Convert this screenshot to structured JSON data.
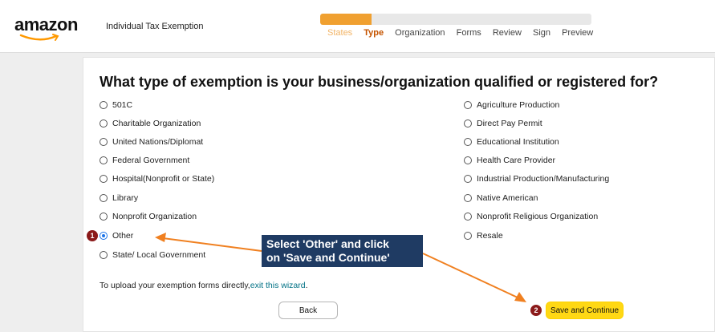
{
  "header": {
    "logo": "amazon",
    "app_title": "Individual Tax Exemption",
    "progress_fraction": 0.19,
    "steps": [
      {
        "label": "States",
        "state": "done"
      },
      {
        "label": "Type",
        "state": "active"
      },
      {
        "label": "Organization",
        "state": "pending"
      },
      {
        "label": "Forms",
        "state": "pending"
      },
      {
        "label": "Review",
        "state": "pending"
      },
      {
        "label": "Sign",
        "state": "pending"
      },
      {
        "label": "Preview",
        "state": "pending"
      }
    ]
  },
  "main": {
    "question": "What type of exemption is your business/organization qualified or registered for?",
    "left_options": [
      {
        "label": "501C",
        "checked": false
      },
      {
        "label": "Charitable Organization",
        "checked": false
      },
      {
        "label": "United Nations/Diplomat",
        "checked": false
      },
      {
        "label": "Federal Government",
        "checked": false
      },
      {
        "label": "Hospital(Nonprofit or State)",
        "checked": false
      },
      {
        "label": "Library",
        "checked": false
      },
      {
        "label": "Nonprofit Organization",
        "checked": false
      },
      {
        "label": "Other",
        "checked": true
      },
      {
        "label": "State/ Local Government",
        "checked": false
      }
    ],
    "right_options": [
      {
        "label": "Agriculture Production",
        "checked": false
      },
      {
        "label": "Direct Pay Permit",
        "checked": false
      },
      {
        "label": "Educational Institution",
        "checked": false
      },
      {
        "label": "Health Care Provider",
        "checked": false
      },
      {
        "label": "Industrial Production/Manufacturing",
        "checked": false
      },
      {
        "label": "Native American",
        "checked": false
      },
      {
        "label": "Nonprofit Religious Organization",
        "checked": false
      },
      {
        "label": "Resale",
        "checked": false
      }
    ],
    "upload_note_prefix": "To upload your exemption forms directly,",
    "upload_note_link": "exit this wizard",
    "upload_note_suffix": ".",
    "back_label": "Back",
    "save_label": "Save and Continue"
  },
  "annotation": {
    "callout_line1": "Select 'Other' and click",
    "callout_line2": "on 'Save and Continue'",
    "badge1": "1",
    "badge2": "2",
    "arrow_color": "#f08020",
    "badge_color": "#8b1a1a"
  }
}
